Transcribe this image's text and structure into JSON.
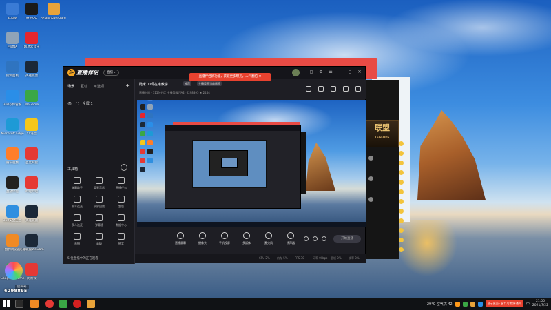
{
  "desktop": {
    "icons_col1": [
      {
        "label": "此电脑",
        "icon": "computer-icon",
        "color": "#3a7bd5"
      },
      {
        "label": "回收站",
        "icon": "recycle-bin-icon",
        "color": "#8fa3b8"
      },
      {
        "label": "控制面板",
        "icon": "control-panel-icon",
        "color": "#2f74c0"
      },
      {
        "label": "360软件管家",
        "icon": "app-store-icon",
        "color": "#2a8ee8"
      },
      {
        "label": "Microsoft Edge",
        "icon": "edge-icon",
        "color": "#1e9ad6"
      },
      {
        "label": "腾讯视频",
        "icon": "video-icon",
        "color": "#ff7e2a"
      },
      {
        "label": "直播伴侣",
        "icon": "live-icon",
        "color": "#222222"
      },
      {
        "label": "360安全卫士",
        "icon": "shield-icon",
        "color": "#2f8fe0"
      },
      {
        "label": "猎豹浏览器",
        "icon": "browser-icon",
        "color": "#f08a24"
      },
      {
        "label": "Google Chrome",
        "icon": "chrome-icon",
        "color": "#34a853"
      }
    ],
    "icons_col2": [
      {
        "label": "腾讯QQ",
        "icon": "qq-icon",
        "color": "#1a1a1a"
      },
      {
        "label": "网易云音乐",
        "icon": "music-icon",
        "color": "#e5262f"
      },
      {
        "label": "英雄联盟",
        "icon": "lol-icon",
        "color": "#1b2838"
      },
      {
        "label": "WeGame",
        "icon": "wegame-icon",
        "color": "#3aa745"
      },
      {
        "label": "YY语音",
        "icon": "yy-icon",
        "color": "#f5c71a"
      },
      {
        "label": "百度网盘",
        "icon": "cloud-icon",
        "color": "#e53935"
      },
      {
        "label": "哔哩哔哩",
        "icon": "bilibili-icon",
        "color": "#e53935"
      },
      {
        "label": "英雄联盟",
        "icon": "lol-icon",
        "color": "#1b2838"
      },
      {
        "label": "英雄联盟WeGame版",
        "icon": "lol-icon",
        "color": "#1b2838"
      },
      {
        "label": "网易云",
        "icon": "music-icon",
        "color": "#e53935"
      }
    ],
    "icons_col3": [
      {
        "label": "英雄联盟WeGame版",
        "icon": "wegame-icon",
        "color": "#e8a33a"
      }
    ]
  },
  "app": {
    "logo_mark": "斗",
    "logo_text": "直播伴侣",
    "version_pill": "直播 ▸",
    "promo_banner": "直播伴侣新功能，获取更多曝光，人气翻倍 ✕",
    "window_controls": [
      "◻",
      "⚙",
      "☰",
      "—",
      "◻",
      "✕"
    ],
    "sidebar": {
      "tabs": [
        "场景",
        "互动",
        "可选项"
      ],
      "add_label": "+",
      "scene_items": [
        "👁",
        "⛶",
        "全屏 1"
      ],
      "tools_header": "工具箱",
      "tools_toggle": "−",
      "tools": [
        {
          "label": "弹幕助手",
          "icon": "chat-icon"
        },
        {
          "label": "背景音乐",
          "icon": "music-icon"
        },
        {
          "label": "直播任务",
          "icon": "task-icon"
        },
        {
          "label": "观众连麦",
          "icon": "mic-icon"
        },
        {
          "label": "录屏回放",
          "icon": "record-icon"
        },
        {
          "label": "超管",
          "icon": "admin-icon"
        },
        {
          "label": "多人连麦",
          "icon": "group-icon"
        },
        {
          "label": "弹幕墙",
          "icon": "wall-icon"
        },
        {
          "label": "数据中心",
          "icon": "data-icon"
        },
        {
          "label": "直播",
          "icon": "live-icon"
        },
        {
          "label": "高级",
          "icon": "star-icon"
        },
        {
          "label": "抽奖",
          "icon": "gift-icon"
        }
      ],
      "footer": "5 位直播中的正在观看"
    },
    "header": {
      "room_title": "酷米TD现在电教学",
      "tags": [
        "推荐",
        "主播设置当前标签"
      ],
      "meta": "直播时间 · 315%分区    主播等级(VA2)  6298895      ★ 2454",
      "icons": [
        "gift-icon",
        "lock-icon",
        "share-icon",
        "bell-icon",
        "more-icon"
      ]
    },
    "controls": [
      {
        "label": "直播屏幕",
        "icon": "screen-icon"
      },
      {
        "label": "摄像头",
        "icon": "camera-icon"
      },
      {
        "label": "手机投屏",
        "icon": "phone-icon"
      },
      {
        "label": "多媒体",
        "icon": "media-icon"
      },
      {
        "label": "麦克风",
        "icon": "mic-icon"
      },
      {
        "label": "扬声器",
        "icon": "speaker-icon"
      }
    ],
    "start_live_label": "开始直播",
    "status_items": [
      "CPU 2%",
      "内存 5%",
      "FPS 30",
      "码率 0kbps",
      "丢帧 0%",
      "帧率 0%"
    ]
  },
  "watermark": {
    "badge": "房间号",
    "number": "6298895"
  },
  "secondary_window": {
    "logo_text": "联盟",
    "logo_sub": "LEGENDS",
    "lines": [
      "...",
      "...",
      "..."
    ]
  },
  "taskbar": {
    "weather": "29°C 空气优 42",
    "notification": "显示桌面 · 窗口/小程序通知",
    "time": "21:05",
    "date": "2021/7/22",
    "tray_lang": "中"
  }
}
